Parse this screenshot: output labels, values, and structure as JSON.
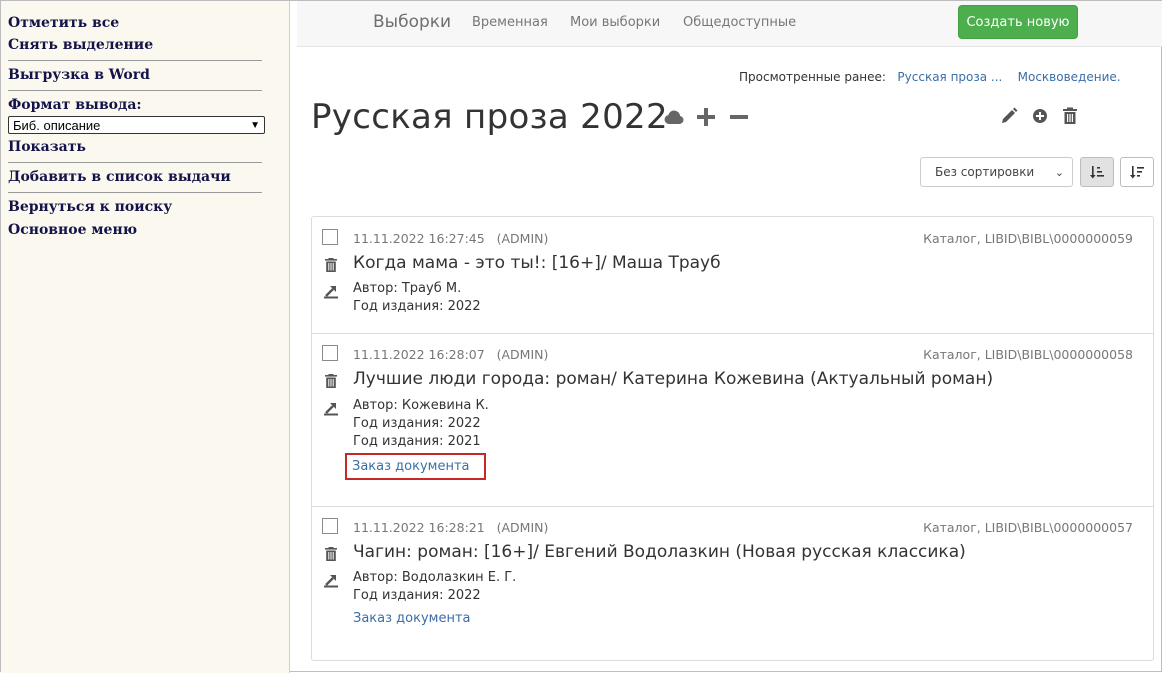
{
  "sidebar": {
    "select_all": "Отметить все",
    "deselect": "Снять выделение",
    "export_word": "Выгрузка в Word",
    "format_label": "Формат вывода:",
    "format_value": "Биб. описание",
    "show": "Показать",
    "add_to_list": "Добавить в список выдачи",
    "back_to_search": "Вернуться к поиску",
    "main_menu": "Основное меню"
  },
  "nav": {
    "items": [
      "Выборки",
      "Временная",
      "Мои выборки",
      "Общедоступные"
    ],
    "create_label": "Создать новую"
  },
  "viewed": {
    "label": "Просмотренные ранее:",
    "links": [
      "Русская проза ...",
      "Москвоведение."
    ]
  },
  "page": {
    "title": "Русская проза 2022"
  },
  "sort": {
    "value": "Без сортировки"
  },
  "records": [
    {
      "datetime": "11.11.2022 16:27:45",
      "user": "(ADMIN)",
      "catalog": "Каталог, LIBID\\BIBL\\0000000059",
      "title": "Когда мама - это ты!: [16+]/ Маша Трауб",
      "lines": [
        "Автор: Трауб М.",
        "Год издания: 2022"
      ],
      "order": ""
    },
    {
      "datetime": "11.11.2022 16:28:07",
      "user": "(ADMIN)",
      "catalog": "Каталог, LIBID\\BIBL\\0000000058",
      "title": "Лучшие люди города: роман/ Катерина Кожевина (Актуальный роман)",
      "lines": [
        "Автор: Кожевина К.",
        "Год издания: 2022",
        "Год издания: 2021"
      ],
      "order": "Заказ документа"
    },
    {
      "datetime": "11.11.2022 16:28:21",
      "user": "(ADMIN)",
      "catalog": "Каталог, LIBID\\BIBL\\0000000057",
      "title": "Чагин: роман: [16+]/ Евгений Водолазкин (Новая русская классика)",
      "lines": [
        "Автор: Водолазкин Е. Г.",
        "Год издания: 2022"
      ],
      "order": "Заказ документа"
    }
  ],
  "colors": {
    "accent_green": "#4cae4c",
    "link_blue": "#3c6ea6",
    "sidebar_bg": "#fbf9ef",
    "highlight_red": "#c62828"
  }
}
